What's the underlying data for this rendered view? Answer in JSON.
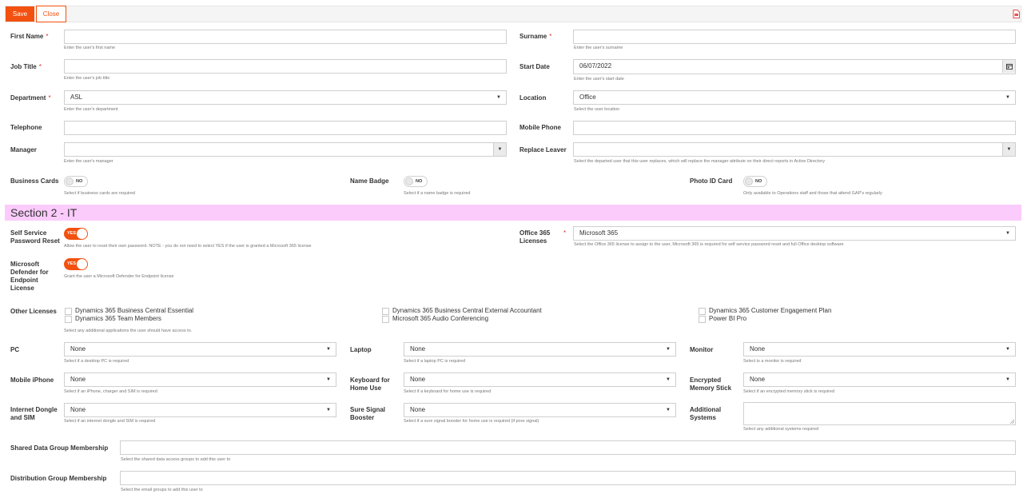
{
  "toolbar": {
    "save": "Save",
    "close": "Close"
  },
  "fields": {
    "first_name": {
      "label": "First Name",
      "help": "Enter the user's first name",
      "value": ""
    },
    "surname": {
      "label": "Surname",
      "help": "Enter the user's surname",
      "value": ""
    },
    "job_title": {
      "label": "Job Title",
      "help": "Enter the user's job title",
      "value": ""
    },
    "start_date": {
      "label": "Start Date",
      "help": "Enter the user's start date",
      "value": "06/07/2022"
    },
    "department": {
      "label": "Department",
      "help": "Enter the user's department",
      "value": "ASL"
    },
    "location": {
      "label": "Location",
      "help": "Select the user location",
      "value": "Office"
    },
    "telephone": {
      "label": "Telephone",
      "value": ""
    },
    "mobile_phone": {
      "label": "Mobile Phone",
      "value": ""
    },
    "manager": {
      "label": "Manager",
      "help": "Enter the user's manager",
      "value": ""
    },
    "replace_leaver": {
      "label": "Replace Leaver",
      "help": "Select the departed user that this user replaces, which will replace the manager attribute on their direct reports in Active Directory",
      "value": ""
    },
    "business_cards": {
      "label": "Business Cards",
      "toggle": "NO",
      "help": "Select if business cards are required"
    },
    "name_badge": {
      "label": "Name Badge",
      "toggle": "NO",
      "help": "Select if a name badge is required"
    },
    "photo_id": {
      "label": "Photo ID Card",
      "toggle": "NO",
      "help": "Only available to Operations staff and those that attend GAP's regularly"
    }
  },
  "section2": {
    "title": "Section 2 - IT",
    "sspr": {
      "label_line1": "Self Service",
      "label_line2": "Password Reset",
      "toggle": "YES",
      "help": "Allow the user to reset their own password. NOTE - you do not need to select YES if the user is granted a Microsoft 365 license"
    },
    "o365": {
      "label_line1": "Office 365",
      "label_line2": "Licenses",
      "value": "Microsoft 365",
      "help": "Select the Office 365 license to assign to the user, Microsoft 365 is required for self service password reset and full Office desktop software"
    },
    "defender": {
      "label_line1": "Microsoft",
      "label_line2": "Defender for",
      "label_line3": "Endpoint",
      "label_line4": "License",
      "toggle": "YES",
      "help": "Grant the user a Microsoft Defender for Endpoint license"
    },
    "other_licenses": {
      "label": "Other Licenses",
      "help": "Select any additional applications the user should have access to.",
      "items": [
        "Dynamics 365 Business Central Essential",
        "Dynamics 365 Team Members",
        "Dynamics 365 Business Central External Accountant",
        "Microsoft 365 Audio Conferencing",
        "Dynamics 365 Customer Engagement Plan",
        "Power BI Pro"
      ]
    },
    "pc": {
      "label": "PC",
      "value": "None",
      "help": "Select if a desktop PC is required"
    },
    "laptop": {
      "label": "Laptop",
      "value": "None",
      "help": "Select if a laptop PC is required"
    },
    "monitor": {
      "label": "Monitor",
      "value": "None",
      "help": "Select is a monitor is required"
    },
    "mobile_iphone": {
      "label": "Mobile iPhone",
      "value": "None",
      "help": "Select if an iPhone, charger and SIM is required"
    },
    "keyboard": {
      "label_line1": "Keyboard for",
      "label_line2": "Home Use",
      "value": "None",
      "help": "Select if a keyboard for home use is required"
    },
    "memory_stick": {
      "label_line1": "Encrypted",
      "label_line2": "Memory Stick",
      "value": "None",
      "help": "Select if an encrypted memory stick is required"
    },
    "dongle": {
      "label_line1": "Internet Dongle",
      "label_line2": "and SIM",
      "value": "None",
      "help": "Select if an internet dongle and SIM is required"
    },
    "booster": {
      "label_line1": "Sure Signal",
      "label_line2": "Booster",
      "value": "None",
      "help": "Select if a sure signal booster for home use is required (if poor signal)"
    },
    "additional_systems": {
      "label_line1": "Additional",
      "label_line2": "Systems",
      "help": "Select any additional systems required"
    },
    "shared_data": {
      "label": "Shared Data Group Membership",
      "help": "Select the shared data access groups to add this user to"
    },
    "distribution": {
      "label": "Distribution Group Membership",
      "help": "Select the email groups to add this user to"
    }
  },
  "colors": {
    "accent": "#f2510f",
    "section_bg": "#fbcbfb",
    "required": "#d9342b"
  },
  "icons": {
    "document": "pdf-document-icon",
    "calendar": "calendar-icon",
    "dropdown": "chevron-down-icon"
  }
}
